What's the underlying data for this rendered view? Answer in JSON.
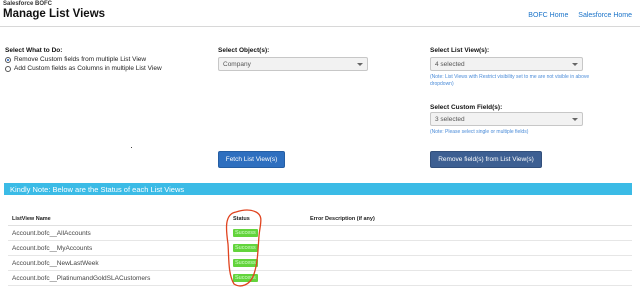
{
  "header": {
    "brand": "Salesforce BOFC",
    "title": "Manage List Views",
    "links": [
      "BOFC Home",
      "Salesforce Home"
    ]
  },
  "what_to_do": {
    "label": "Select What to Do:",
    "options": [
      {
        "label": "Remove Custom fields from multiple List View",
        "checked": true
      },
      {
        "label": "Add Custom fields as Columns in multiple List View",
        "checked": false
      }
    ]
  },
  "objects": {
    "label": "Select Object(s):",
    "value": "Company"
  },
  "list_views": {
    "label": "Select List View(s):",
    "value": "4 selected",
    "note": "(Note: List Views with Restrict visibility set to me are not visible in above dropdown)"
  },
  "custom_fields": {
    "label": "Select Custom Field(s):",
    "value": "3 selected",
    "note": "(Note: Please select single or multiple fields)"
  },
  "buttons": {
    "fetch": "Fetch List View(s)",
    "remove": "Remove field(s) from List View(s)"
  },
  "banner": "Kindly Note: Below are the Status of each List Views",
  "table": {
    "headers": {
      "name": "ListView Name",
      "status": "Status",
      "error": "Error Description (if any)"
    },
    "rows": [
      {
        "name": "Account.bofc__AllAccounts",
        "status": "Success",
        "error": ""
      },
      {
        "name": "Account.bofc__MyAccounts",
        "status": "Success",
        "error": ""
      },
      {
        "name": "Account.bofc__NewLastWeek",
        "status": "Success",
        "error": ""
      },
      {
        "name": "Account.bofc__PlatinumandGoldSLACustomers",
        "status": "Success",
        "error": ""
      }
    ]
  },
  "colors": {
    "banner": "#3bbbe6",
    "success": "#63d43c",
    "fetch_button": "#2e6fbf",
    "remove_button": "#3d5f92",
    "annotation": "#e0431f"
  }
}
